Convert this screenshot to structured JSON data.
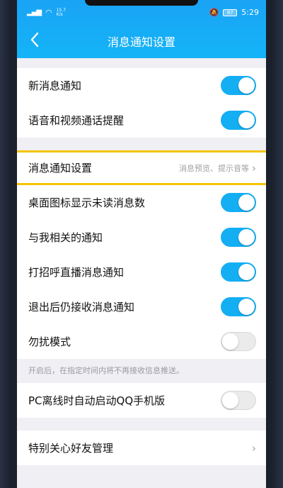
{
  "status_bar": {
    "signal_text": "15.7\nK/s",
    "battery": "87",
    "time": "5:29"
  },
  "header": {
    "title": "消息通知设置"
  },
  "colors": {
    "accent": "#14aef3",
    "highlight_border": "#f5c400"
  },
  "group1": {
    "items": [
      {
        "label": "新消息通知",
        "toggle": "on"
      },
      {
        "label": "语音和视频通话提醒",
        "toggle": "on"
      }
    ]
  },
  "group2": {
    "highlight": {
      "label": "消息通知设置",
      "hint": "消息预览、提示音等"
    },
    "items": [
      {
        "label": "桌面图标显示未读消息数",
        "toggle": "on"
      },
      {
        "label": "与我相关的通知",
        "toggle": "on"
      },
      {
        "label": "打招呼直播消息通知",
        "toggle": "on"
      },
      {
        "label": "退出后仍接收消息通知",
        "toggle": "on"
      },
      {
        "label": "勿扰模式",
        "toggle": "off"
      }
    ],
    "note": "开启后，在指定时间内将不再接收信息推送。"
  },
  "group3": {
    "label": "PC离线时自动启动QQ手机版",
    "toggle": "off"
  },
  "group4": {
    "label": "特别关心好友管理"
  }
}
